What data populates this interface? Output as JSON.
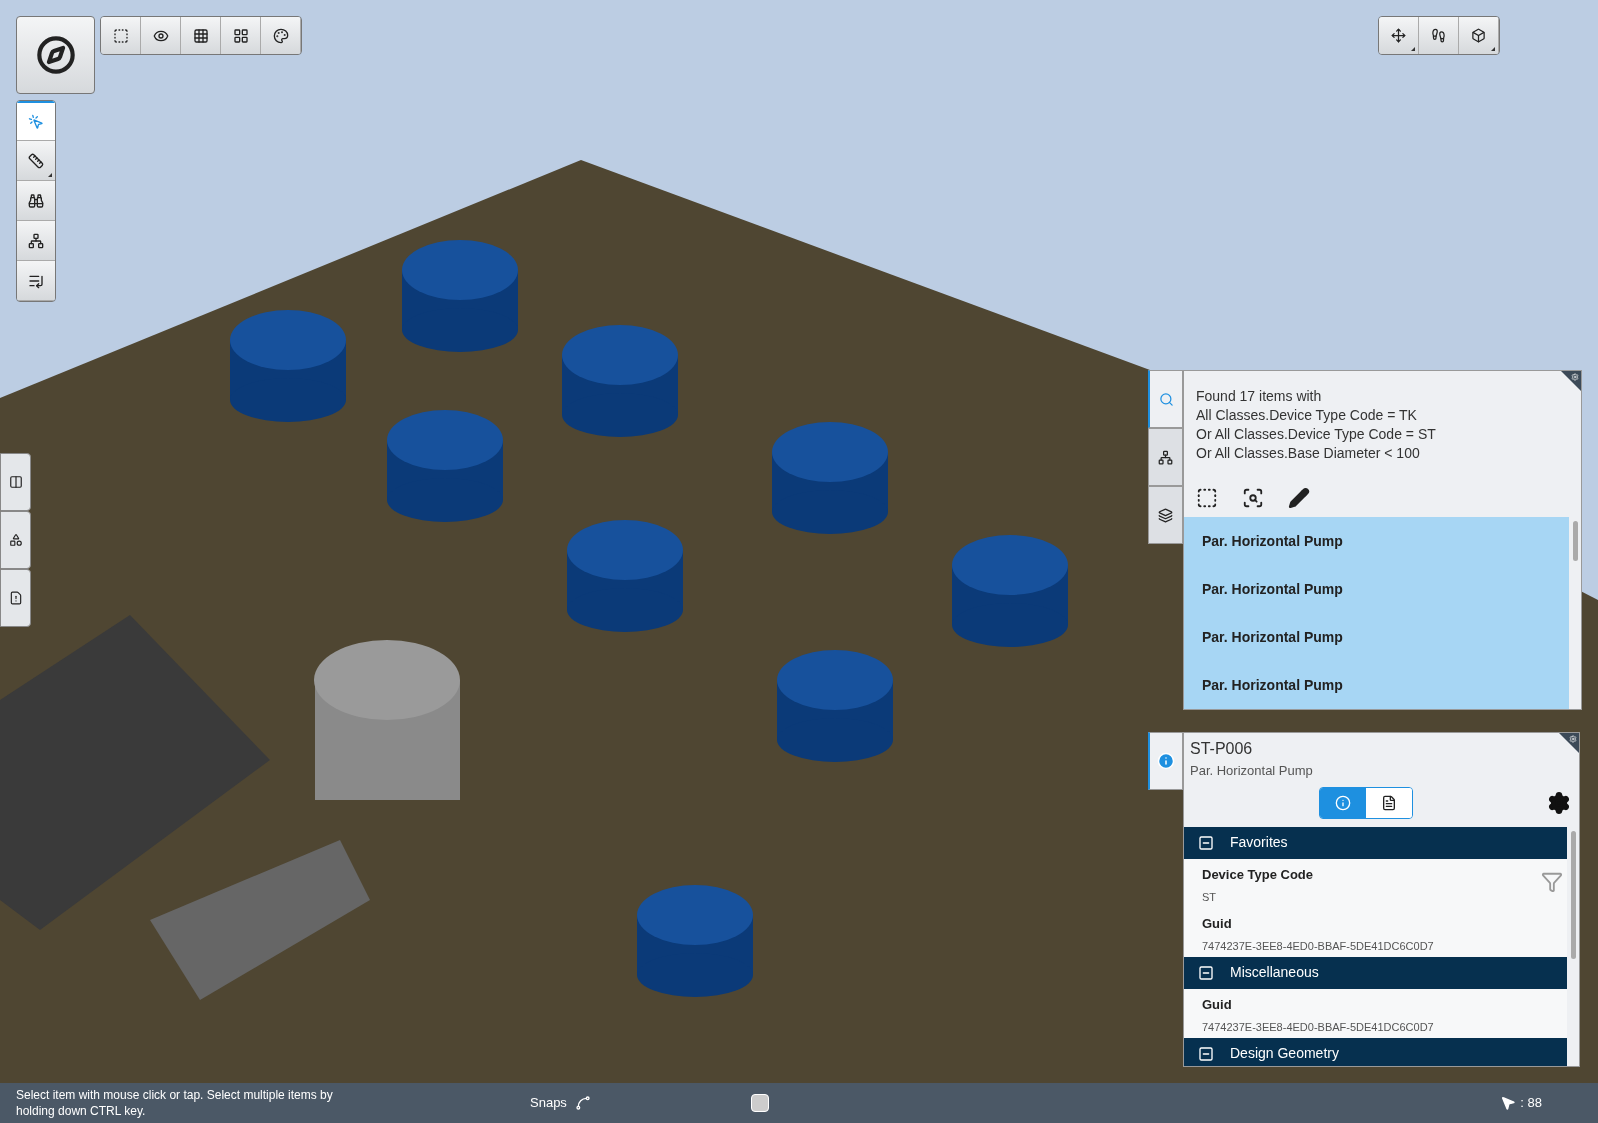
{
  "left_toolbar": [
    {
      "kind": "select",
      "selected": true,
      "has_menu": false
    },
    {
      "kind": "measure",
      "selected": false,
      "has_menu": true
    },
    {
      "kind": "binoculars",
      "selected": false,
      "has_menu": false
    },
    {
      "kind": "connect",
      "selected": false,
      "has_menu": false
    },
    {
      "kind": "sequence",
      "selected": false,
      "has_menu": false
    }
  ],
  "top_toolbar": [
    {
      "kind": "select-box"
    },
    {
      "kind": "hide"
    },
    {
      "kind": "grid"
    },
    {
      "kind": "isolate"
    },
    {
      "kind": "palette"
    }
  ],
  "top_right_toolbar": [
    {
      "kind": "pan",
      "has_menu": true
    },
    {
      "kind": "walk",
      "has_menu": false
    },
    {
      "kind": "view-cube",
      "has_menu": true
    }
  ],
  "side_tabs": [
    {
      "kind": "split"
    },
    {
      "kind": "markup"
    },
    {
      "kind": "report"
    }
  ],
  "search_panel": {
    "tabs": [
      {
        "kind": "search",
        "selected": true
      },
      {
        "kind": "hierarchy",
        "selected": false
      },
      {
        "kind": "layers",
        "selected": false
      }
    ],
    "summary": [
      "Found 17 items with",
      "All Classes.Device Type Code = TK",
      "Or All Classes.Device Type Code = ST",
      "Or All Classes.Base Diameter < 100"
    ],
    "results": [
      {
        "label": "Par. Horizontal Pump",
        "selected": true
      },
      {
        "label": "Par. Horizontal Pump",
        "selected": true
      },
      {
        "label": "Par. Horizontal Pump",
        "selected": true
      },
      {
        "label": "Par. Horizontal Pump",
        "selected": true
      }
    ]
  },
  "properties_panel": {
    "title": "ST-P006",
    "subtitle": "Par. Horizontal Pump",
    "views": [
      {
        "kind": "properties",
        "selected": true
      },
      {
        "kind": "documents",
        "selected": false
      }
    ],
    "sections": [
      {
        "title": "Favorites",
        "expanded": true,
        "properties": [
          {
            "name": "Device Type Code",
            "value": "ST"
          },
          {
            "name": "Guid",
            "value": "7474237E-3EE8-4ED0-BBAF-5DE41DC6C0D7"
          }
        ]
      },
      {
        "title": "Miscellaneous",
        "expanded": true,
        "properties": [
          {
            "name": "Guid",
            "value": "7474237E-3EE8-4ED0-BBAF-5DE41DC6C0D7"
          }
        ]
      },
      {
        "title": "Design Geometry",
        "expanded": true
      }
    ]
  },
  "status_bar": {
    "hint": "Select item with mouse click or tap. Select multiple items by holding down CTRL key.",
    "snaps": "Snaps",
    "count": ": 88"
  }
}
